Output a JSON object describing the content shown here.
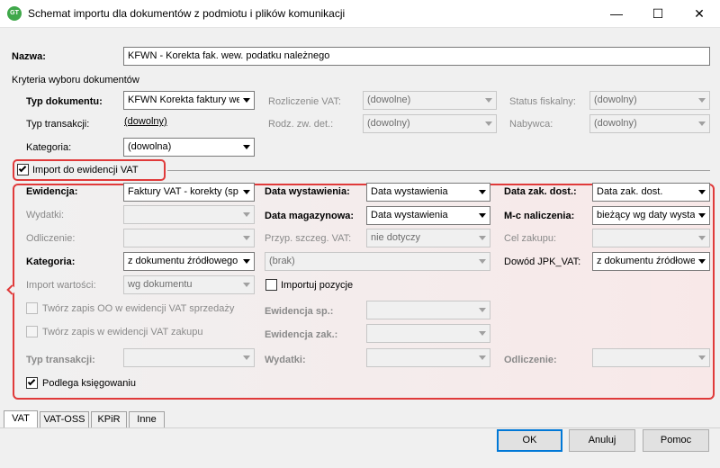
{
  "window": {
    "app_icon": "GT",
    "title": "Schemat importu dla dokumentów z podmiotu i plików komunikacji",
    "minimize": "—",
    "maximize": "☐",
    "close": "✕"
  },
  "nazwa": {
    "label": "Nazwa:",
    "value": "KFWN - Korekta fak. wew. podatku należnego"
  },
  "kryteria": {
    "title": "Kryteria wyboru dokumentów",
    "typ_dokumentu": {
      "label": "Typ dokumentu:",
      "value": "KFWN Korekta faktury we"
    },
    "typ_transakcji": {
      "label": "Typ transakcji:",
      "value": "(dowolny)"
    },
    "kategoria": {
      "label": "Kategoria:",
      "value": "(dowolna)"
    },
    "rozliczenie_vat": {
      "label": "Rozliczenie VAT:",
      "value": "(dowolne)"
    },
    "rodz_zw_det": {
      "label": "Rodz. zw. det.:",
      "value": "(dowolny)"
    },
    "status_fiskalny": {
      "label": "Status fiskalny:",
      "value": "(dowolny)"
    },
    "nabywca": {
      "label": "Nabywca:",
      "value": "(dowolny)"
    }
  },
  "import_vat": {
    "label": "Import do ewidencji VAT",
    "checked": true
  },
  "vat": {
    "ewidencja": {
      "label": "Ewidencja:",
      "value": "Faktury VAT - korekty (sp"
    },
    "wydatki": {
      "label": "Wydatki:",
      "value": ""
    },
    "odliczenie": {
      "label": "Odliczenie:",
      "value": ""
    },
    "kategoria": {
      "label": "Kategoria:",
      "value": "z dokumentu źródłowego"
    },
    "import_wartosci": {
      "label": "Import wartości:",
      "value": "wg dokumentu"
    },
    "zapis_oo": {
      "label": "Twórz zapis OO w ewidencji VAT sprzedaży"
    },
    "zapis_zakupu": {
      "label": "Twórz zapis w ewidencji VAT zakupu"
    },
    "typ_transakcji": {
      "label": "Typ transakcji:",
      "value": ""
    },
    "podlega": {
      "label": "Podlega księgowaniu",
      "checked": true
    },
    "data_wystawienia": {
      "label": "Data wystawienia:",
      "value": "Data wystawienia"
    },
    "data_magazynowa": {
      "label": "Data magazynowa:",
      "value": "Data wystawienia"
    },
    "przyp_szczeg": {
      "label": "Przyp. szczeg. VAT:",
      "value": "nie dotyczy"
    },
    "brak": {
      "value": "(brak)"
    },
    "importuj_pozycje": {
      "label": "Importuj pozycje",
      "checked": false
    },
    "ewidencja_sp": {
      "label": "Ewidencja sp.:",
      "value": ""
    },
    "ewidencja_zak": {
      "label": "Ewidencja zak.:",
      "value": ""
    },
    "wydatki2": {
      "label": "Wydatki:",
      "value": ""
    },
    "data_zak_dost": {
      "label": "Data zak. dost.:",
      "value": "Data zak. dost."
    },
    "mc_naliczenia": {
      "label": "M-c naliczenia:",
      "value": "bieżący wg daty wysta"
    },
    "cel_zakupu": {
      "label": "Cel zakupu:",
      "value": ""
    },
    "dowod_jpk": {
      "label": "Dowód JPK_VAT:",
      "value": "z dokumentu źródłowe"
    },
    "odliczenie2": {
      "label": "Odliczenie:",
      "value": ""
    }
  },
  "tabs": [
    "VAT",
    "VAT-OSS",
    "KPiR",
    "Inne"
  ],
  "buttons": {
    "ok": "OK",
    "cancel": "Anuluj",
    "help": "Pomoc"
  },
  "colors": {
    "highlight": "#e03a3a",
    "default_button": "#0078d7"
  }
}
